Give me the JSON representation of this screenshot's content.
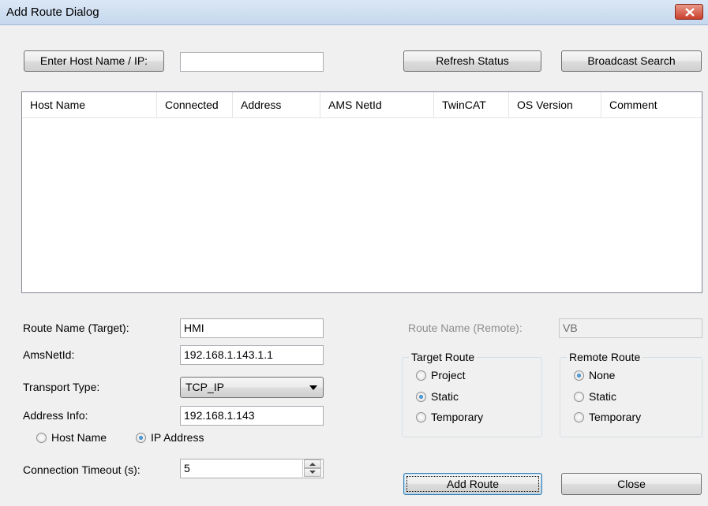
{
  "window": {
    "title": "Add Route Dialog"
  },
  "top": {
    "enter_host_label": "Enter Host Name / IP:",
    "host_input_value": "",
    "refresh_label": "Refresh Status",
    "broadcast_label": "Broadcast Search"
  },
  "table": {
    "columns": [
      "Host Name",
      "Connected",
      "Address",
      "AMS NetId",
      "TwinCAT",
      "OS Version",
      "Comment"
    ],
    "rows": []
  },
  "form": {
    "route_name_label": "Route Name (Target):",
    "route_name_value": "HMI",
    "amsnetid_label": "AmsNetId:",
    "amsnetid_value": "192.168.1.143.1.1",
    "transport_label": "Transport Type:",
    "transport_value": "TCP_IP",
    "address_label": "Address Info:",
    "address_value": "192.168.1.143",
    "hostname_radio": "Host Name",
    "ip_radio": "IP Address",
    "timeout_label": "Connection Timeout (s):",
    "timeout_value": "5",
    "remote_name_label": "Route Name (Remote):",
    "remote_name_value": "VB"
  },
  "target_route": {
    "title": "Target Route",
    "options": [
      "Project",
      "Static",
      "Temporary"
    ],
    "selected": "Static"
  },
  "remote_route": {
    "title": "Remote Route",
    "options": [
      "None",
      "Static",
      "Temporary"
    ],
    "selected": "None"
  },
  "buttons": {
    "add_route": "Add Route",
    "close": "Close"
  },
  "colors": {
    "title_bar": "#c5d8ee",
    "close_button": "#c9402c",
    "default_button_border": "#3c7fb1"
  }
}
